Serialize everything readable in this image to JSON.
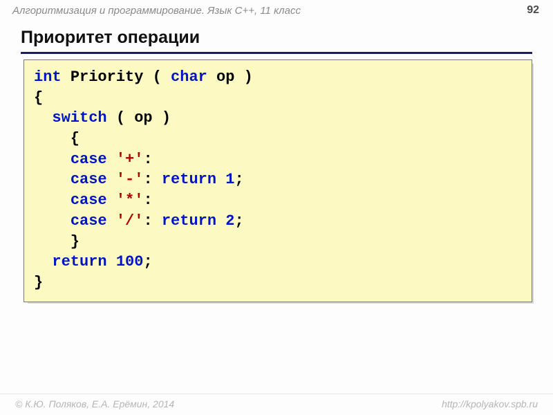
{
  "header": {
    "title": "Алгоритмизация и программирование. Язык C++, 11 класс",
    "page_number": "92"
  },
  "title": "Приоритет операции",
  "code": {
    "l1_kw_int": "int",
    "l1_sp1": " ",
    "l1_name": "Priority",
    "l1_sp2": " ( ",
    "l1_kw_char": "char",
    "l1_tail": " op )",
    "l2": "{",
    "l3_pad": "  ",
    "l3_kw_switch": "switch",
    "l3_tail": " ( op )",
    "l4": "    {",
    "l5_pad": "    ",
    "l5_kw_case": "case",
    "l5_sp": " ",
    "l5_str": "'+'",
    "l5_tail": ":",
    "l6_pad": "    ",
    "l6_kw_case": "case",
    "l6_sp": " ",
    "l6_str": "'-'",
    "l6_mid": ": ",
    "l6_kw_return": "return",
    "l6_sp2": " ",
    "l6_num": "1",
    "l6_tail": ";",
    "l7_pad": "    ",
    "l7_kw_case": "case",
    "l7_sp": " ",
    "l7_str": "'*'",
    "l7_tail": ":",
    "l8_pad": "    ",
    "l8_kw_case": "case",
    "l8_sp": " ",
    "l8_str": "'/'",
    "l8_mid": ": ",
    "l8_kw_return": "return",
    "l8_sp2": " ",
    "l8_num": "2",
    "l8_tail": ";",
    "l9": "    }",
    "l10_pad": "  ",
    "l10_kw_return": "return",
    "l10_sp": " ",
    "l10_num": "100",
    "l10_tail": ";",
    "l11": "}"
  },
  "footer": {
    "left": "© К.Ю. Поляков, Е.А. Ерёмин, 2014",
    "right": "http://kpolyakov.spb.ru"
  }
}
